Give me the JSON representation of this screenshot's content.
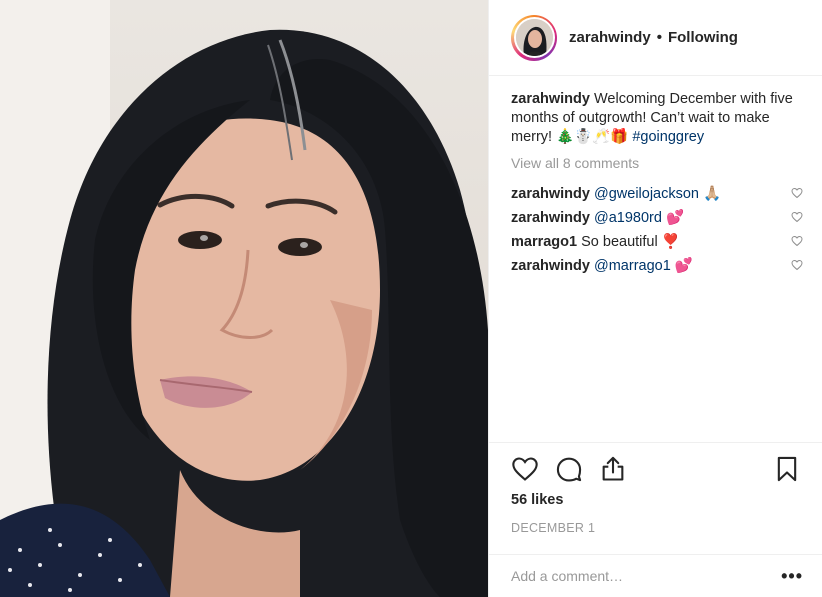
{
  "post": {
    "author": "zarahwindy",
    "separator": "•",
    "follow_status": "Following",
    "caption": {
      "username": "zarahwindy",
      "text": "Welcoming December with five months of outgrowth! Can’t wait to make merry! 🎄☃️🥂🎁",
      "hashtag": "#goinggrey"
    },
    "view_all_comments": "View all 8 comments",
    "comments": [
      {
        "username": "zarahwindy",
        "mention": "@gweilojackson",
        "text": "🙏🏼"
      },
      {
        "username": "zarahwindy",
        "mention": "@a1980rd",
        "text": "💕"
      },
      {
        "username": "marrago1",
        "mention": "",
        "text": "So beautiful ❣️"
      },
      {
        "username": "zarahwindy",
        "mention": "@marrago1",
        "text": "💕"
      }
    ],
    "likes": "56 likes",
    "date": "DECEMBER 1",
    "comment_placeholder": "Add a comment…",
    "more_label": "•••"
  },
  "icons": {
    "like": "heart-icon",
    "comment": "comment-bubble-icon",
    "share": "share-icon",
    "save": "bookmark-icon",
    "comment_like": "small-heart-icon"
  },
  "colors": {
    "text": "#262626",
    "muted": "#999999",
    "link": "#003569",
    "border": "#efefef"
  }
}
